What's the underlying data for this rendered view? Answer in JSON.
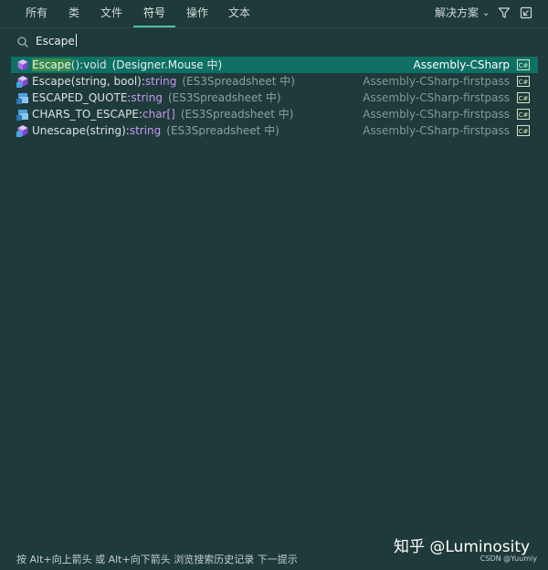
{
  "tabs": [
    {
      "label": "所有"
    },
    {
      "label": "类"
    },
    {
      "label": "文件"
    },
    {
      "label": "符号"
    },
    {
      "label": "操作"
    },
    {
      "label": "文本"
    }
  ],
  "active_tab": "符号",
  "scope_label": "解决方案",
  "search": {
    "query": "Escape"
  },
  "results": [
    {
      "match": "Escape",
      "name": "():void",
      "type": "",
      "context": "(Designer.Mouse 中)",
      "assembly": "Assembly-CSharp",
      "selected": true,
      "icon": "cube-icon"
    },
    {
      "match": "",
      "name": "Escape(string, bool):",
      "type": "string",
      "context": "(ES3Spreadsheet 中)",
      "assembly": "Assembly-CSharp-firstpass",
      "selected": false,
      "icon": "static-method-icon"
    },
    {
      "match": "",
      "name": "ESCAPED_QUOTE:",
      "type": "string",
      "context": "(ES3Spreadsheet 中)",
      "assembly": "Assembly-CSharp-firstpass",
      "selected": false,
      "icon": "static-field-icon"
    },
    {
      "match": "",
      "name": "CHARS_TO_ESCAPE:",
      "type": "char[]",
      "context": "(ES3Spreadsheet 中)",
      "assembly": "Assembly-CSharp-firstpass",
      "selected": false,
      "icon": "static-field-icon"
    },
    {
      "match": "",
      "name": "Unescape(string):",
      "type": "string",
      "context": "(ES3Spreadsheet 中)",
      "assembly": "Assembly-CSharp-firstpass",
      "selected": false,
      "icon": "static-method-icon"
    }
  ],
  "status_text": "按 Alt+向上箭头 或 Alt+向下箭头 浏览搜索历史记录  下一提示",
  "watermark": "知乎 @Luminosity",
  "csdn_mark": "CSDN @Yuumiy",
  "colors": {
    "accent": "#4fc0a9",
    "selected_row": "#0e7065",
    "type_purple": "#c19af2",
    "background": "#1f3a3a"
  }
}
